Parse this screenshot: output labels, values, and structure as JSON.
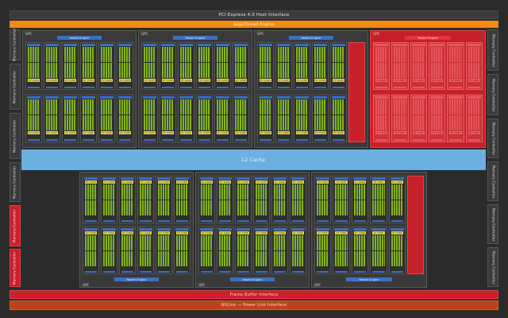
{
  "top": {
    "pcie_label": "PCI Express 4.0 Host Interface",
    "giga_label": "GigaThread Engine"
  },
  "memory_controllers": {
    "left": [
      "Memory Controller",
      "Memory Controller",
      "Memory Controller",
      "Memory Controller",
      "Memory Controller",
      "Memory Controller"
    ],
    "right": [
      "Memory Controller",
      "Memory Controller",
      "Memory Controller",
      "Memory Controller",
      "Memory Controller",
      "Memory Controller"
    ]
  },
  "l2_label": "L2 Cache",
  "gpc": {
    "title": "GPC",
    "raster_label": "Raster Engine",
    "rt_label": "RT CORE"
  },
  "bottom": {
    "fb_label": "Frame Buffer Interface",
    "nvlink_label": "NVLink — Power Link Interface"
  },
  "colors": {
    "accent_orange": "#f08a1c",
    "disabled_red": "#c8202a",
    "l2_blue": "#6db0e0",
    "core_green": "#7fb81e",
    "rt_yellow": "#e6d84a"
  }
}
